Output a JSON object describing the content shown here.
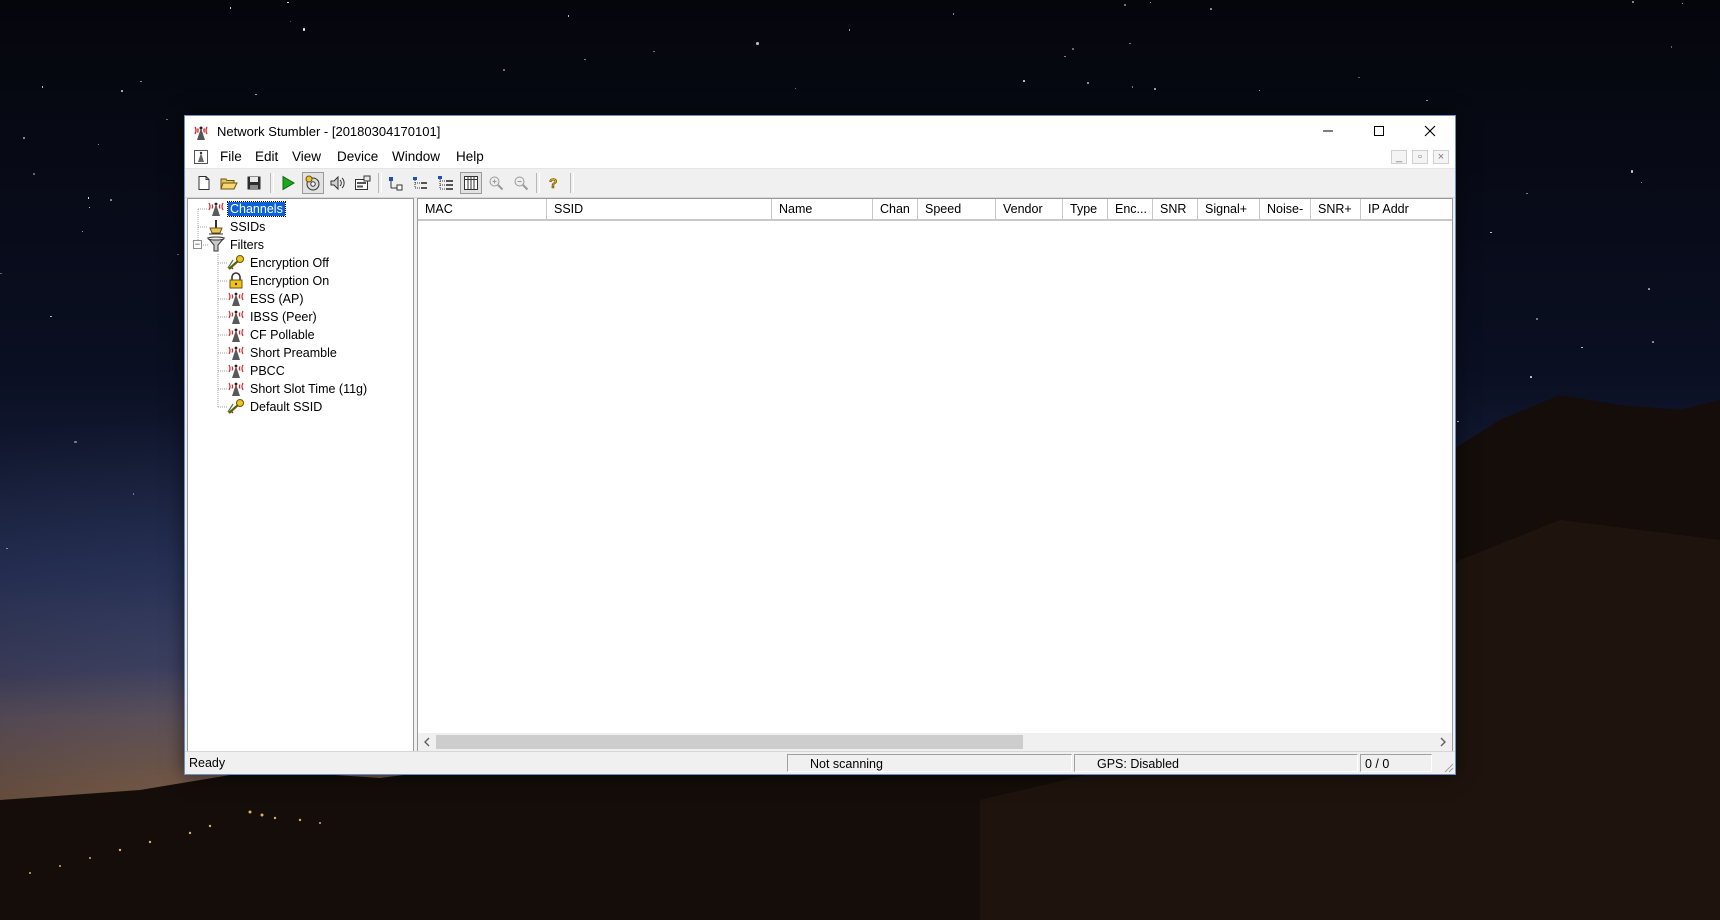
{
  "window": {
    "title": "Network Stumbler - [20180304170101]",
    "minimize_icon": "minimize-icon",
    "maximize_icon": "maximize-icon",
    "close_icon": "close-icon"
  },
  "menu": {
    "items": [
      "File",
      "Edit",
      "View",
      "Device",
      "Window",
      "Help"
    ]
  },
  "toolbar": {
    "buttons": [
      "new-file-icon",
      "open-folder-icon",
      "save-icon",
      "start-scan-icon",
      "auto-config-icon",
      "sound-icon",
      "device-properties-icon",
      "ap-icon",
      "tree-collapse-icon",
      "tree-expand-icon",
      "columns-icon",
      "zoom-in-icon",
      "zoom-out-icon",
      "help-icon"
    ]
  },
  "tree": {
    "root": [
      {
        "label": "Channels",
        "icon": "antenna-icon",
        "selected": true
      },
      {
        "label": "SSIDs",
        "icon": "ssid-icon"
      },
      {
        "label": "Filters",
        "icon": "funnel-icon",
        "expanded": true
      }
    ],
    "filters": [
      {
        "label": "Encryption Off",
        "icon": "key-icon"
      },
      {
        "label": "Encryption On",
        "icon": "lock-icon"
      },
      {
        "label": "ESS (AP)",
        "icon": "antenna-icon"
      },
      {
        "label": "IBSS (Peer)",
        "icon": "antenna-icon"
      },
      {
        "label": "CF Pollable",
        "icon": "antenna-icon"
      },
      {
        "label": "Short Preamble",
        "icon": "antenna-icon"
      },
      {
        "label": "PBCC",
        "icon": "antenna-icon"
      },
      {
        "label": "Short Slot Time (11g)",
        "icon": "antenna-icon"
      },
      {
        "label": "Default SSID",
        "icon": "key-icon"
      }
    ]
  },
  "list": {
    "columns": [
      "MAC",
      "SSID",
      "Name",
      "Chan",
      "Speed",
      "Vendor",
      "Type",
      "Enc...",
      "SNR",
      "Signal+",
      "Noise-",
      "SNR+",
      "IP Addr"
    ],
    "rows": []
  },
  "status": {
    "ready": "Ready",
    "scan": "Not scanning",
    "gps": "GPS: Disabled",
    "count": "0 / 0"
  },
  "colors": {
    "selection": "#0b61d8",
    "window_border": "#6b8fc9",
    "play_green": "#1fa51f"
  }
}
